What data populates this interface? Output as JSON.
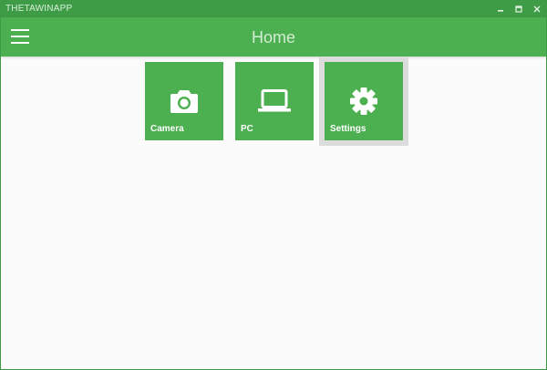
{
  "window": {
    "title": "THETAWINAPP"
  },
  "appbar": {
    "title": "Home"
  },
  "tiles": [
    {
      "label": "Camera",
      "icon": "camera-icon"
    },
    {
      "label": "PC",
      "icon": "laptop-icon"
    },
    {
      "label": "Settings",
      "icon": "gear-icon",
      "focused": true
    }
  ],
  "colors": {
    "titlebar": "#3f9c46",
    "appbar": "#4caf50",
    "tile": "#4caf50",
    "focus": "#dcdcdc",
    "background": "#fbfbfb"
  }
}
